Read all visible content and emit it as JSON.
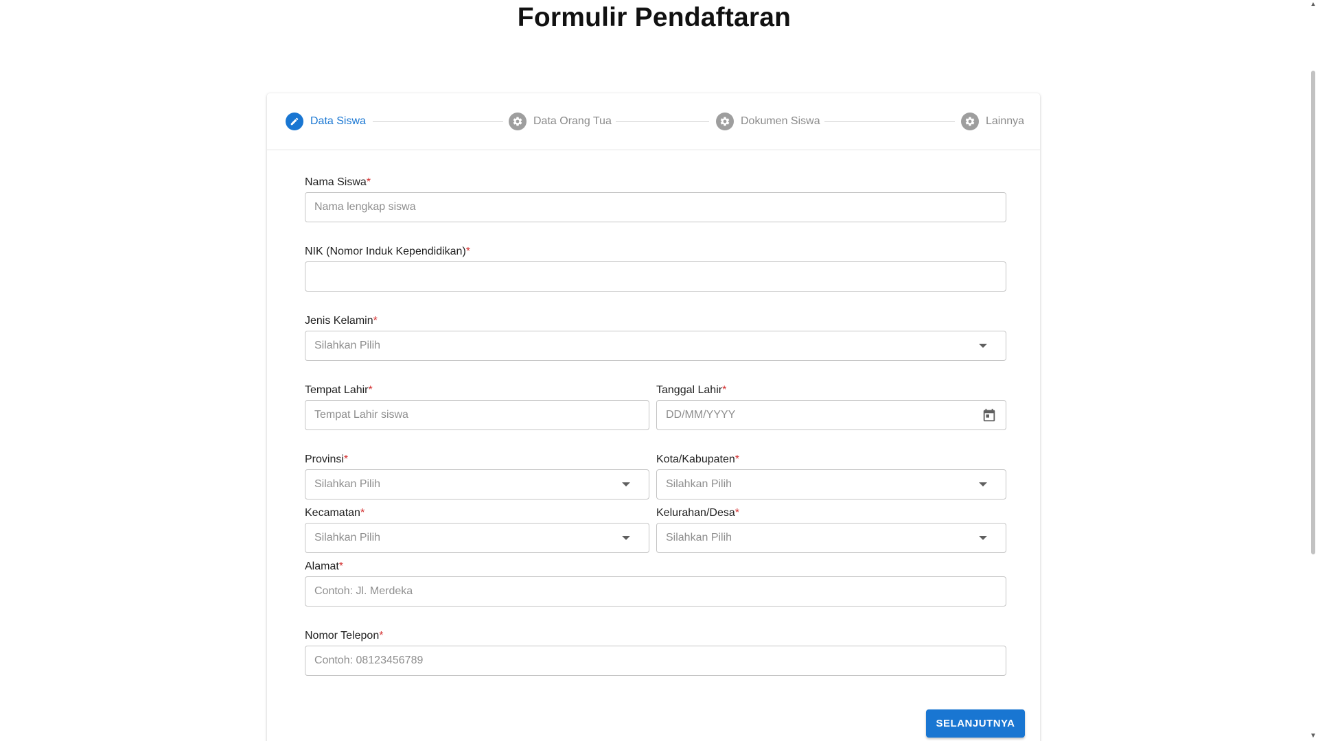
{
  "page": {
    "title": "Formulir Pendaftaran"
  },
  "stepper": {
    "steps": [
      {
        "label": "Data Siswa",
        "icon": "pencil-icon",
        "active": true
      },
      {
        "label": "Data Orang Tua",
        "icon": "gear-icon",
        "active": false
      },
      {
        "label": "Dokumen Siswa",
        "icon": "gear-icon",
        "active": false
      },
      {
        "label": "Lainnya",
        "icon": "gear-icon",
        "active": false
      }
    ]
  },
  "form": {
    "nama_siswa": {
      "label": "Nama Siswa",
      "required": "*",
      "placeholder": "Nama lengkap siswa",
      "value": ""
    },
    "nik": {
      "label": "NIK (Nomor Induk Kependidikan)",
      "required": "*",
      "placeholder": "",
      "value": ""
    },
    "jenis_kelamin": {
      "label": "Jenis Kelamin",
      "required": "*",
      "selected": "Silahkan Pilih"
    },
    "tempat_lahir": {
      "label": "Tempat Lahir",
      "required": "*",
      "placeholder": "Tempat Lahir siswa",
      "value": ""
    },
    "tanggal_lahir": {
      "label": "Tanggal Lahir",
      "required": "*",
      "placeholder": "DD/MM/YYYY",
      "value": ""
    },
    "provinsi": {
      "label": "Provinsi",
      "required": "*",
      "selected": "Silahkan Pilih"
    },
    "kota": {
      "label": "Kota/Kabupaten",
      "required": "*",
      "selected": "Silahkan Pilih"
    },
    "kecamatan": {
      "label": "Kecamatan",
      "required": "*",
      "selected": "Silahkan Pilih"
    },
    "kelurahan": {
      "label": "Kelurahan/Desa",
      "required": "*",
      "selected": "Silahkan Pilih"
    },
    "alamat": {
      "label": "Alamat",
      "required": "*",
      "placeholder": "Contoh: Jl. Merdeka",
      "value": ""
    },
    "telepon": {
      "label": "Nomor Telepon",
      "required": "*",
      "placeholder": "Contoh: 08123456789",
      "value": ""
    }
  },
  "actions": {
    "next_label": "SELANJUTNYA"
  },
  "colors": {
    "primary": "#1976d2",
    "required": "#d32f2f",
    "inactive_step": "#9e9e9e"
  }
}
